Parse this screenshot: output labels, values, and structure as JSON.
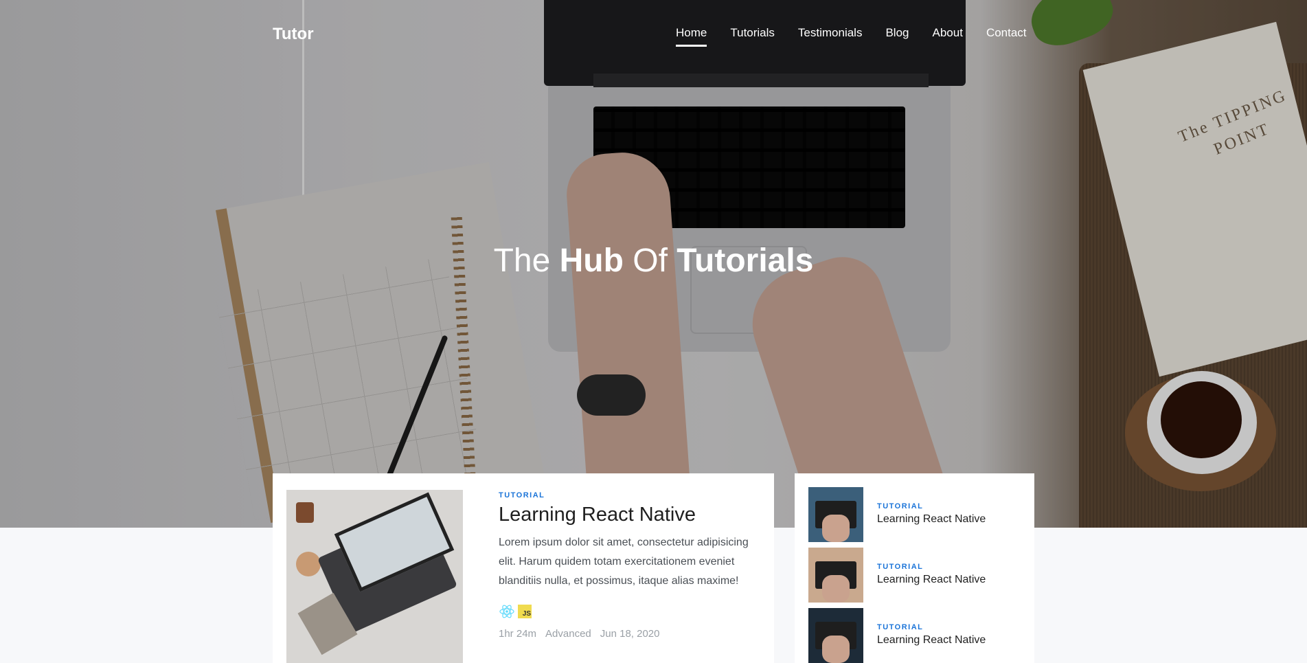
{
  "brand": "Tutor",
  "nav": [
    {
      "label": "Home",
      "active": true
    },
    {
      "label": "Tutorials",
      "active": false
    },
    {
      "label": "Testimonials",
      "active": false
    },
    {
      "label": "Blog",
      "active": false
    },
    {
      "label": "About",
      "active": false
    },
    {
      "label": "Contact",
      "active": false
    }
  ],
  "hero": {
    "title_part1": "The ",
    "title_bold1": "Hub",
    "title_part2": " Of ",
    "title_bold2": "Tutorials",
    "background_image": "desk-laptop-photo",
    "scene_book_text": "The TIPPING POINT"
  },
  "featured": {
    "tag": "TUTORIAL",
    "title": "Learning React Native",
    "description": "Lorem ipsum dolor sit amet, consectetur adipisicing elit. Harum quidem totam exercitationem eveniet blanditiis nulla, et possimus, itaque alias maxime!",
    "icons": [
      "react-icon",
      "js-icon"
    ],
    "js_badge": "JS",
    "duration": "1hr 24m",
    "level": "Advanced",
    "date": "Jun 18, 2020"
  },
  "side": [
    {
      "tag": "TUTORIAL",
      "title": "Learning React Native"
    },
    {
      "tag": "TUTORIAL",
      "title": "Learning React Native"
    },
    {
      "tag": "TUTORIAL",
      "title": "Learning React Native"
    }
  ],
  "colors": {
    "accent": "#1b74d8",
    "js_yellow": "#f0db4f",
    "react_cyan": "#61dafb"
  }
}
